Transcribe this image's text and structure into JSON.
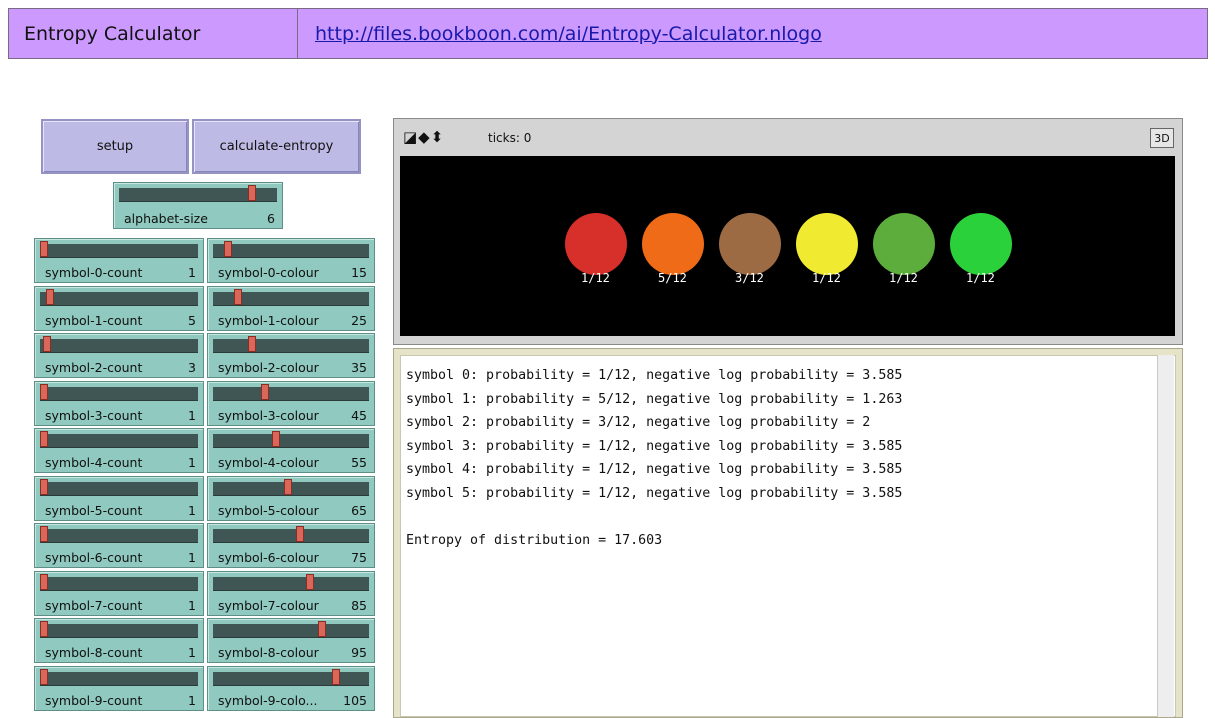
{
  "header": {
    "title": "Entropy Calculator",
    "link": "http://files.bookboon.com/ai/Entropy-Calculator.nlogo"
  },
  "buttons": {
    "setup": "setup",
    "calculate": "calculate-entropy"
  },
  "alphabet": {
    "label": "alphabet-size",
    "value": "6",
    "fraction": 0.85
  },
  "counts": [
    {
      "label": "symbol-0-count",
      "value": "1",
      "fraction": 0.0
    },
    {
      "label": "symbol-1-count",
      "value": "5",
      "fraction": 0.04
    },
    {
      "label": "symbol-2-count",
      "value": "3",
      "fraction": 0.02
    },
    {
      "label": "symbol-3-count",
      "value": "1",
      "fraction": 0.0
    },
    {
      "label": "symbol-4-count",
      "value": "1",
      "fraction": 0.0
    },
    {
      "label": "symbol-5-count",
      "value": "1",
      "fraction": 0.0
    },
    {
      "label": "symbol-6-count",
      "value": "1",
      "fraction": 0.0
    },
    {
      "label": "symbol-7-count",
      "value": "1",
      "fraction": 0.0
    },
    {
      "label": "symbol-8-count",
      "value": "1",
      "fraction": 0.0
    },
    {
      "label": "symbol-9-count",
      "value": "1",
      "fraction": 0.0
    }
  ],
  "colours": [
    {
      "label": "symbol-0-colour",
      "value": "15",
      "fraction": 0.07
    },
    {
      "label": "symbol-1-colour",
      "value": "25",
      "fraction": 0.14
    },
    {
      "label": "symbol-2-colour",
      "value": "35",
      "fraction": 0.23
    },
    {
      "label": "symbol-3-colour",
      "value": "45",
      "fraction": 0.32
    },
    {
      "label": "symbol-4-colour",
      "value": "55",
      "fraction": 0.39
    },
    {
      "label": "symbol-5-colour",
      "value": "65",
      "fraction": 0.47
    },
    {
      "label": "symbol-6-colour",
      "value": "75",
      "fraction": 0.55
    },
    {
      "label": "symbol-7-colour",
      "value": "85",
      "fraction": 0.62
    },
    {
      "label": "symbol-8-colour",
      "value": "95",
      "fraction": 0.7
    },
    {
      "label": "symbol-9-colour",
      "value": "105",
      "fraction": 0.79,
      "label_display": "symbol-9-colo..."
    }
  ],
  "view": {
    "ticks": "ticks: 0",
    "btn3d": "3D"
  },
  "turtles": [
    {
      "label": "1/12",
      "color": "#d7302a"
    },
    {
      "label": "5/12",
      "color": "#f06b17"
    },
    {
      "label": "3/12",
      "color": "#9c6b44"
    },
    {
      "label": "1/12",
      "color": "#f0ea30"
    },
    {
      "label": "1/12",
      "color": "#5cad3c"
    },
    {
      "label": "1/12",
      "color": "#2bd13b"
    }
  ],
  "output": {
    "lines": [
      "symbol 0: probability = 1/12, negative log probability = 3.585",
      "symbol 1: probability = 5/12, negative log probability = 1.263",
      "symbol 2: probability = 3/12, negative log probability = 2",
      "symbol 3: probability = 1/12, negative log probability = 3.585",
      "symbol 4: probability = 1/12, negative log probability = 3.585",
      "symbol 5: probability = 1/12, negative log probability = 3.585",
      "",
      "Entropy of distribution = 17.603"
    ]
  }
}
